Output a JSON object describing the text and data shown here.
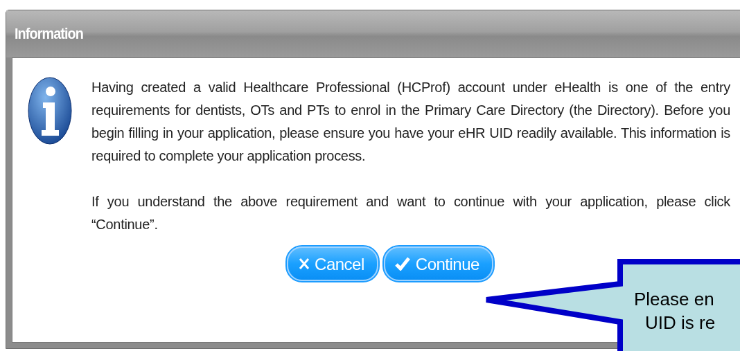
{
  "window": {
    "title": "Information"
  },
  "message": {
    "paragraphs": [
      "Having created a valid Healthcare Professional (HCProf) account under eHealth is one of the entry requirements for dentists, OTs and PTs to enrol in the Primary Care Directory (the Directory). Before you begin filling in your application, please ensure you have your eHR UID readily available. This information is required to complete your application process.",
      "If you understand the above requirement and want to continue with your application, please click “Continue”."
    ]
  },
  "buttons": [
    {
      "kind": "cancel",
      "label": "Cancel"
    },
    {
      "kind": "confirm",
      "label": "Continue"
    }
  ],
  "callout": {
    "lines": [
      "Please en",
      "UID is re"
    ]
  }
}
